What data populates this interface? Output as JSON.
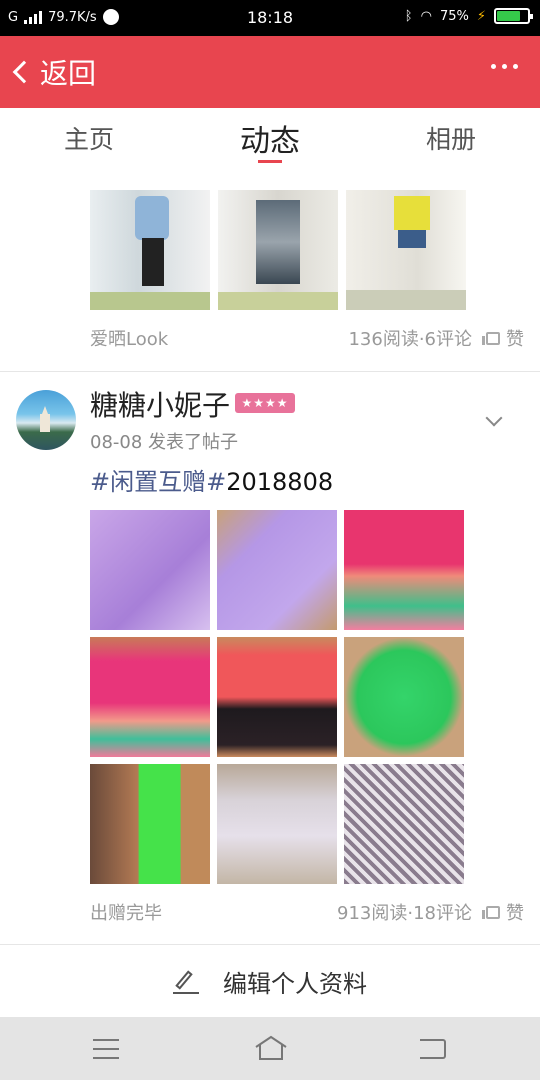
{
  "status_bar": {
    "carrier": "G",
    "speed": "79.7K/s",
    "time": "18:18",
    "battery": "75%",
    "battery_level": 0.75
  },
  "header": {
    "back_label": "返回",
    "more_icon": "more-horizontal-icon"
  },
  "tabs": [
    {
      "label": "主页"
    },
    {
      "label": "动态",
      "active": true
    },
    {
      "label": "相册"
    }
  ],
  "post1": {
    "tag": "爱晒Look",
    "stats": "136阅读·6评论",
    "like_label": "赞"
  },
  "post2": {
    "username": "糖糖小妮子",
    "badge": "★★★★",
    "meta": "08-08 发表了帖子",
    "hashtag": "#闲置互赠#",
    "title_rest": "2018808",
    "tag": "出赠完毕",
    "stats": "913阅读·18评论",
    "like_label": "赞"
  },
  "edit_profile": {
    "label": "编辑个人资料"
  },
  "colors": {
    "brand": "#e8454f",
    "hashtag": "#4b5b8c",
    "badge": "#e8729a"
  }
}
